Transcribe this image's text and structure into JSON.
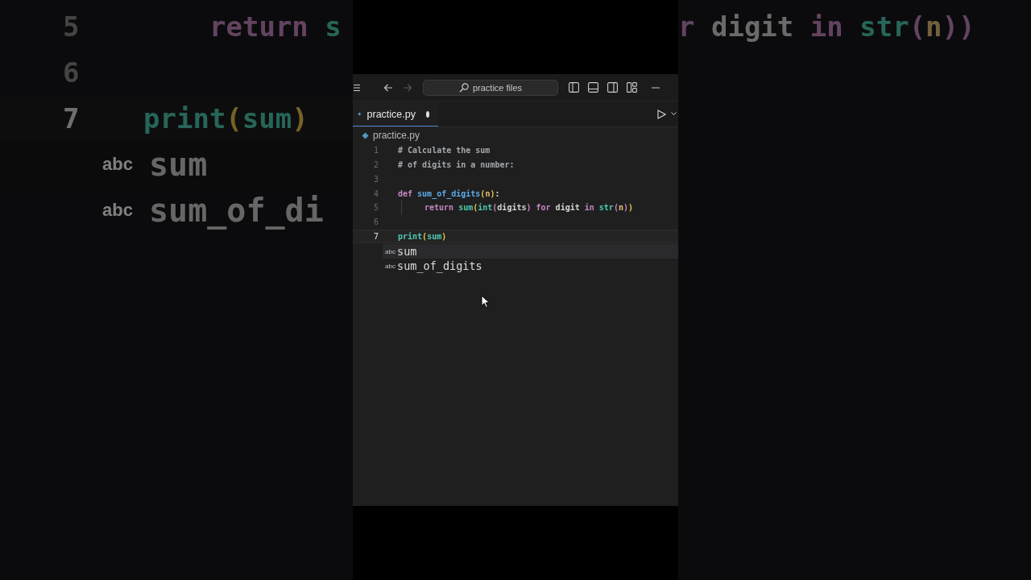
{
  "backdrop_left": {
    "lines": [
      {
        "number": "5",
        "current": false,
        "indented": true,
        "tokens": [
          {
            "text": "return",
            "kind": "keyword"
          },
          {
            "text": " s",
            "kind": "builtin"
          }
        ]
      },
      {
        "number": "6",
        "current": false
      },
      {
        "number": "7",
        "current": true,
        "tokens": [
          {
            "text": "print",
            "kind": "builtin"
          },
          {
            "text": "(",
            "kind": "bracket"
          },
          {
            "text": "sum",
            "kind": "builtin"
          },
          {
            "text": ")",
            "kind": "bracket"
          }
        ]
      }
    ],
    "suggestions": [
      {
        "kind_label": "abc",
        "label": "sum",
        "selected": true
      },
      {
        "kind_label": "abc",
        "label": "sum_of_di",
        "selected": false
      }
    ]
  },
  "editor": {
    "search": "practice files",
    "tab": {
      "label": "practice.py",
      "modified": true,
      "selected": true
    },
    "breadcrumb": "practice.py",
    "lines": [
      {
        "number": "1",
        "current": false,
        "tokens": [
          {
            "text": "# Calculate the sum",
            "kind": "comment"
          }
        ]
      },
      {
        "number": "2",
        "current": false,
        "tokens": [
          {
            "text": "# of digits in a number:",
            "kind": "comment"
          }
        ]
      },
      {
        "number": "3",
        "current": false
      },
      {
        "number": "4",
        "current": false,
        "tokens": [
          {
            "text": "def",
            "kind": "keyword"
          },
          {
            "text": " sum_of_digits",
            "kind": "function"
          },
          {
            "text": "(",
            "kind": "bracket"
          },
          {
            "text": "n",
            "kind": "param"
          },
          {
            "text": ")",
            "kind": "bracket"
          },
          {
            "text": ":",
            "kind": "plain"
          }
        ]
      },
      {
        "number": "5",
        "current": false,
        "indented": true,
        "tokens": [
          {
            "text": "return",
            "kind": "keyword"
          },
          {
            "text": " sum",
            "kind": "builtin"
          },
          {
            "text": "(",
            "kind": "bracket"
          },
          {
            "text": "int",
            "kind": "builtin"
          },
          {
            "text": "(",
            "kind": "bracket2"
          },
          {
            "text": "digits",
            "kind": "plain"
          },
          {
            "text": ")",
            "kind": "bracket2"
          },
          {
            "text": " for",
            "kind": "keyword"
          },
          {
            "text": " digit",
            "kind": "plain"
          },
          {
            "text": " in",
            "kind": "keyword"
          },
          {
            "text": " str",
            "kind": "builtin"
          },
          {
            "text": "(",
            "kind": "bracket2"
          },
          {
            "text": "n",
            "kind": "param"
          },
          {
            "text": ")",
            "kind": "bracket2"
          },
          {
            "text": ")",
            "kind": "bracket"
          }
        ]
      },
      {
        "number": "6",
        "current": false
      },
      {
        "number": "7",
        "current": true,
        "tokens": [
          {
            "text": "print",
            "kind": "builtin"
          },
          {
            "text": "(",
            "kind": "bracket"
          },
          {
            "text": "sum",
            "kind": "builtin"
          },
          {
            "text": ")",
            "kind": "bracket"
          }
        ]
      }
    ],
    "suggestions": [
      {
        "kind_label": "abc",
        "label": "sum",
        "selected": true
      },
      {
        "kind_label": "abc",
        "label": "sum_of_digits",
        "selected": false
      }
    ]
  },
  "backdrop_right": {
    "tokens": [
      {
        "text": "r",
        "kind": "keyword"
      },
      {
        "text": " digit",
        "kind": "plain"
      },
      {
        "text": " in",
        "kind": "keyword"
      },
      {
        "text": " str",
        "kind": "builtin"
      },
      {
        "text": "(",
        "kind": "bracket2"
      },
      {
        "text": "n",
        "kind": "param"
      },
      {
        "text": "))",
        "kind": "bracket2"
      }
    ]
  }
}
